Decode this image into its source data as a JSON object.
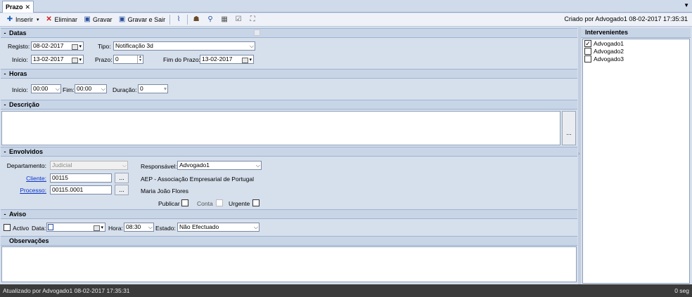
{
  "tab": {
    "title": "Prazo",
    "close": "✕"
  },
  "toolbar": {
    "insert": "Inserir",
    "delete": "Eliminar",
    "save": "Gravar",
    "save_exit": "Gravar e Sair",
    "created": "Criado por Advogado1 08-02-2017 17:35:31"
  },
  "datas": {
    "header": "Datas",
    "registo_label": "Registo:",
    "registo": "08-02-2017",
    "tipo_label": "Tipo:",
    "tipo": "Notificação 3d",
    "inicio_label": "Início:",
    "inicio": "13-02-2017",
    "prazo_label": "Prazo:",
    "prazo": "0",
    "fim_label": "Fim do Prazo:",
    "fim": "13-02-2017"
  },
  "horas": {
    "header": "Horas",
    "inicio_label": "Início:",
    "inicio": "00:00",
    "fim_label": "Fim:",
    "fim": "00:00",
    "duracao_label": "Duração:",
    "duracao": "0"
  },
  "descricao": {
    "header": "Descrição",
    "more": "..."
  },
  "envolvidos": {
    "header": "Envolvidos",
    "departamento_label": "Departamento:",
    "departamento": "Judicial",
    "cliente_label": "Cliente:",
    "cliente": "00115",
    "processo_label": "Processo:",
    "processo": "00115.0001",
    "more": "...",
    "responsavel_label": "Responsável:",
    "responsavel": "Advogado1",
    "cliente_nome": "AEP - Associação Empresarial de Portugal",
    "processo_nome": "Maria João Flores",
    "publicar": "Publicar",
    "conta": "Conta",
    "urgente": "Urgente"
  },
  "aviso": {
    "header": "Aviso",
    "activo": "Activo",
    "data_label": "Data:",
    "hora_label": "Hora:",
    "hora": "08:30",
    "estado_label": "Estado:",
    "estado": "Não Efectuado"
  },
  "observacoes": {
    "header": "Observações"
  },
  "intervenientes": {
    "header": "Intervenientes",
    "items": [
      {
        "label": "Advogado1",
        "checked": true
      },
      {
        "label": "Advogado2",
        "checked": false
      },
      {
        "label": "Advogado3",
        "checked": false
      }
    ]
  },
  "status": {
    "text": "Atualizado por Advogado1 08-02-2017 17:35:31",
    "elapsed": "0 seg"
  }
}
